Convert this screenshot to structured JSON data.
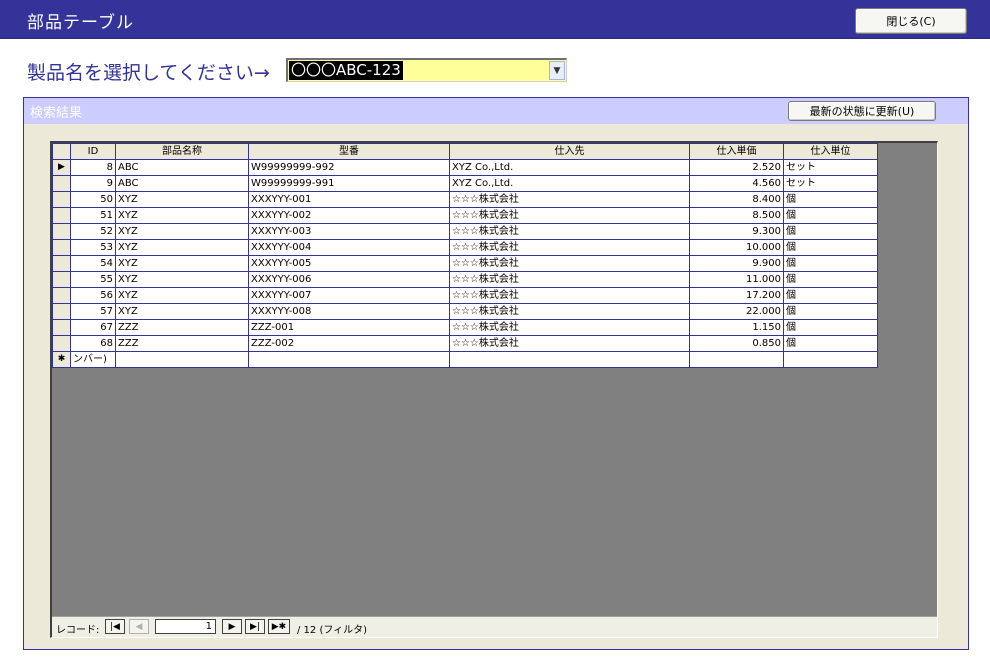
{
  "window": {
    "title": "部品テーブル"
  },
  "toolbar": {
    "close_label": "閉じる(C)"
  },
  "selector": {
    "label": "製品名を選択してください→",
    "value": "〇〇〇ABC-123"
  },
  "results": {
    "title": "検索結果",
    "refresh_label": "最新の状態に更新(U)",
    "columns": [
      "ID",
      "部品名称",
      "型番",
      "仕入先",
      "仕入単価",
      "仕入単位"
    ],
    "rows": [
      {
        "selector": "▶",
        "id": "8",
        "name": "ABC",
        "model": "W99999999-992",
        "supplier": "XYZ Co.,Ltd.",
        "price": "2.520",
        "unit": "セット"
      },
      {
        "selector": "",
        "id": "9",
        "name": "ABC",
        "model": "W99999999-991",
        "supplier": "XYZ Co.,Ltd.",
        "price": "4.560",
        "unit": "セット"
      },
      {
        "selector": "",
        "id": "50",
        "name": "XYZ",
        "model": "XXXYYY-001",
        "supplier": "☆☆☆株式会社",
        "price": "8.400",
        "unit": "個"
      },
      {
        "selector": "",
        "id": "51",
        "name": "XYZ",
        "model": "XXXYYY-002",
        "supplier": "☆☆☆株式会社",
        "price": "8.500",
        "unit": "個"
      },
      {
        "selector": "",
        "id": "52",
        "name": "XYZ",
        "model": "XXXYYY-003",
        "supplier": "☆☆☆株式会社",
        "price": "9.300",
        "unit": "個"
      },
      {
        "selector": "",
        "id": "53",
        "name": "XYZ",
        "model": "XXXYYY-004",
        "supplier": "☆☆☆株式会社",
        "price": "10.000",
        "unit": "個"
      },
      {
        "selector": "",
        "id": "54",
        "name": "XYZ",
        "model": "XXXYYY-005",
        "supplier": "☆☆☆株式会社",
        "price": "9.900",
        "unit": "個"
      },
      {
        "selector": "",
        "id": "55",
        "name": "XYZ",
        "model": "XXXYYY-006",
        "supplier": "☆☆☆株式会社",
        "price": "11.000",
        "unit": "個"
      },
      {
        "selector": "",
        "id": "56",
        "name": "XYZ",
        "model": "XXXYYY-007",
        "supplier": "☆☆☆株式会社",
        "price": "17.200",
        "unit": "個"
      },
      {
        "selector": "",
        "id": "57",
        "name": "XYZ",
        "model": "XXXYYY-008",
        "supplier": "☆☆☆株式会社",
        "price": "22.000",
        "unit": "個"
      },
      {
        "selector": "",
        "id": "67",
        "name": "ZZZ",
        "model": "ZZZ-001",
        "supplier": "☆☆☆株式会社",
        "price": "1.150",
        "unit": "個"
      },
      {
        "selector": "",
        "id": "68",
        "name": "ZZZ",
        "model": "ZZZ-002",
        "supplier": "☆☆☆株式会社",
        "price": "0.850",
        "unit": "個"
      }
    ],
    "new_row": {
      "selector": "✱",
      "id": "ンバー)"
    }
  },
  "navigation": {
    "label": "レコード:",
    "current": "1",
    "total": "/ 12 (フィルタ)",
    "first_icon": "first-record-icon",
    "prev_icon": "previous-record-icon",
    "next_icon": "next-record-icon",
    "last_icon": "last-record-icon",
    "new_icon": "new-record-icon"
  },
  "colors": {
    "accent": "#333399",
    "combo_bg": "#ffff99",
    "frame_bg": "#ece9d8",
    "header_band": "#ccccff",
    "grid_bg": "#808080"
  }
}
